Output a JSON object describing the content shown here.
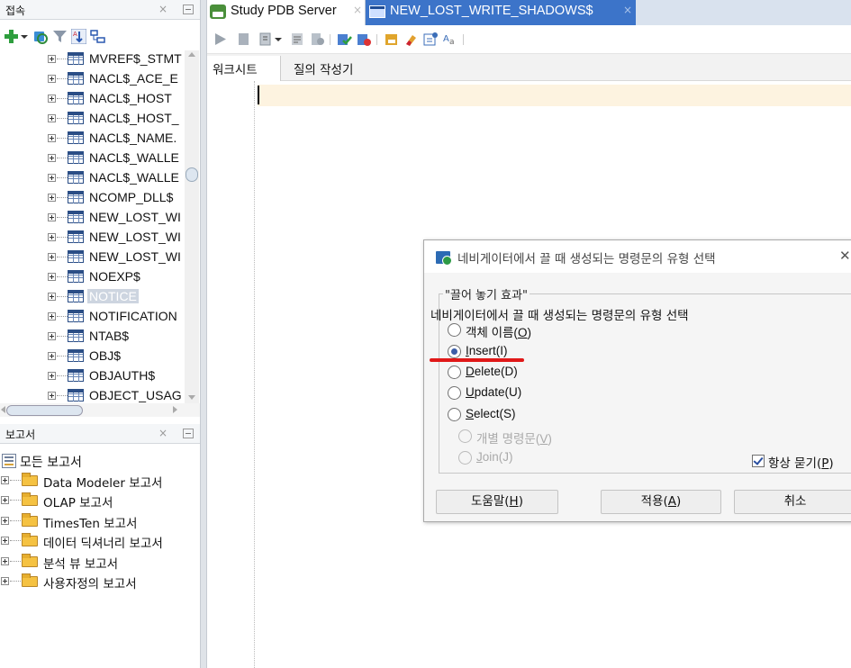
{
  "left": {
    "connections_title": "접속",
    "tree_items": [
      "MVREF$_STMT",
      "NACL$_ACE_E",
      "NACL$_HOST",
      "NACL$_HOST_",
      "NACL$_NAME.",
      "NACL$_WALLE",
      "NACL$_WALLE",
      "NCOMP_DLL$",
      "NEW_LOST_WI",
      "NEW_LOST_WI",
      "NEW_LOST_WI",
      "NOEXP$",
      "NOTICE",
      "NOTIFICATION",
      "NTAB$",
      "OBJ$",
      "OBJAUTH$",
      "OBJECT_USAG"
    ],
    "selected_index": 12,
    "reports_title": "보고서",
    "reports_root": "모든 보고서",
    "reports": [
      "Data Modeler 보고서",
      "OLAP 보고서",
      "TimesTen 보고서",
      "데이터 딕셔너리 보고서",
      "분석 뷰 보고서",
      "사용자정의 보고서"
    ]
  },
  "tabs": [
    {
      "label": "Study PDB Server"
    },
    {
      "label": "NEW_LOST_WRITE_SHADOWS$"
    }
  ],
  "subtabs": [
    "워크시트",
    "질의 작성기"
  ],
  "dialog": {
    "title": "네비게이터에서 끌 때 생성되는 명령문의 유형 선택",
    "group_label": "\"끌어 놓기 효과\"",
    "description": "네비게이터에서 끌 때 생성되는 명령문의 유형 선택",
    "options": [
      {
        "pre": "객체 이름(",
        "key": "O",
        "post": ")",
        "enabled": true,
        "selected": false
      },
      {
        "pre": "",
        "key": "I",
        "post": "nsert(I)",
        "enabled": true,
        "selected": true
      },
      {
        "pre": "",
        "key": "D",
        "post": "elete(D)",
        "enabled": true,
        "selected": false
      },
      {
        "pre": "",
        "key": "U",
        "post": "pdate(U)",
        "enabled": true,
        "selected": false
      },
      {
        "pre": "",
        "key": "S",
        "post": "elect(S)",
        "enabled": true,
        "selected": false
      },
      {
        "pre": "개별 명령문(",
        "key": "V",
        "post": ")",
        "enabled": false,
        "selected": false
      },
      {
        "pre": "",
        "key": "J",
        "post": "oin(J)",
        "enabled": false,
        "selected": false
      }
    ],
    "always_ask": {
      "pre": "항상 묻기(",
      "key": "P",
      "post": ")",
      "checked": true
    },
    "buttons": {
      "help": {
        "pre": "도움말(",
        "key": "H",
        "post": ")"
      },
      "apply": {
        "pre": "적용(",
        "key": "A",
        "post": ")"
      },
      "cancel": "취소"
    }
  },
  "colors": {
    "active_tab": "#3c74c9",
    "current_line": "#fdf3e0",
    "annotation_underline": "#e01818"
  }
}
